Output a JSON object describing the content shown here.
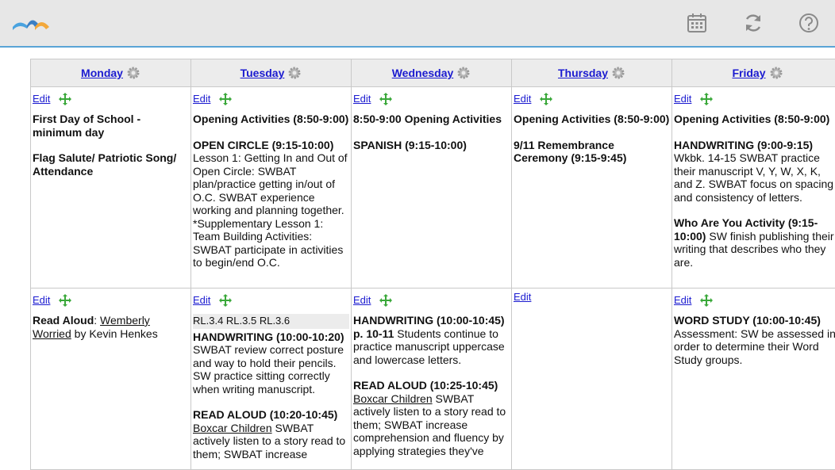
{
  "days": [
    {
      "label": "Monday"
    },
    {
      "label": "Tuesday"
    },
    {
      "label": "Wednesday"
    },
    {
      "label": "Thursday"
    },
    {
      "label": "Friday"
    }
  ],
  "edit_label": "Edit",
  "row1": {
    "mon": {
      "b1": "First Day of School - minimum day",
      "b2": "Flag Salute/ Patriotic Song/ Attendance"
    },
    "tue": {
      "b1": "Opening Activities (8:50-9:00)",
      "b2_title": "OPEN CIRCLE (9:15-10:00)",
      "b2_text": "Lesson 1: Getting In and Out of Open Circle: SWBAT plan/practice getting in/out of O.C.  SWBAT experience working and planning together. *Supplementary Lesson 1: Team Building Activities: SWBAT participate in activities to begin/end O.C."
    },
    "wed": {
      "b1": "8:50-9:00 Opening Activities",
      "b2": "SPANISH (9:15-10:00)"
    },
    "thu": {
      "b1": "Opening Activities (8:50-9:00)",
      "b2": "9/11 Remembrance Ceremony (9:15-9:45)"
    },
    "fri": {
      "b1": "Opening Activities (8:50-9:00)",
      "b2_title": "HANDWRITING (9:00-9:15)",
      "b2_text": "Wkbk. 14-15 SWBAT practice their manuscript V, Y, W, X, K, and Z. SWBAT focus on spacing and consistency of letters.",
      "b3_title": "Who Are You Activity (9:15-10:00)",
      "b3_text": " SW finish publishing their writing that describes who they are."
    }
  },
  "row2": {
    "mon": {
      "prefix": "Read Aloud",
      "colon": ": ",
      "book": "Wemberly Worried",
      "suffix": " by Kevin Henkes"
    },
    "tue": {
      "standards": "RL.3.4   RL.3.5   RL.3.6",
      "b1_title": "HANDWRITING (10:00-10:20)",
      "b1_text": "SWBAT review correct posture and way to hold their pencils. SW practice sitting correctly when writing manuscript.",
      "b2_title": "READ ALOUD (10:20-10:45)",
      "b2_book": "Boxcar Children",
      "b2_text": " SWBAT actively listen to a story read to them; SWBAT increase"
    },
    "wed": {
      "b1_title": "HANDWRITING (10:00-10:45) p. 10-11",
      "b1_text": " Students continue to practice manuscript uppercase and lowercase letters.",
      "b2_title": "READ ALOUD (10:25-10:45)",
      "b2_book": "Boxcar Children",
      "b2_text": " SWBAT actively listen to a story read to them; SWBAT increase comprehension and fluency by applying strategies they've"
    },
    "fri": {
      "b1_title": "WORD STUDY (10:00-10:45)",
      "b1_text": " Assessment: SW be assessed in order to determine their Word Study groups."
    }
  },
  "colors": {
    "link": "#1b1bd0",
    "accent": "#5aa4d6",
    "move_icon": "#3aa83a"
  }
}
